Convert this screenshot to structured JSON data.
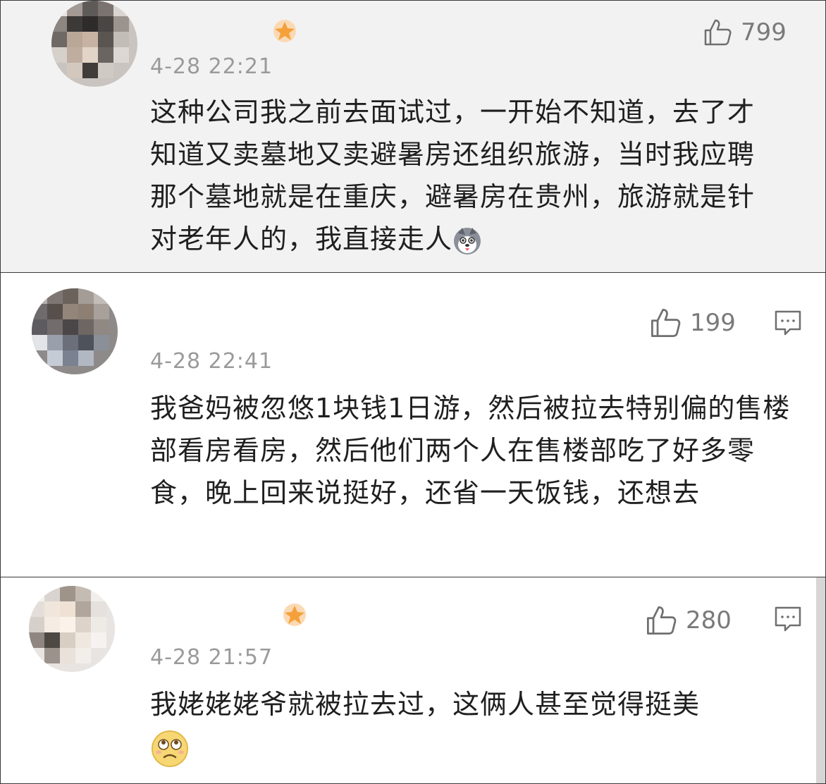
{
  "colors": {
    "background_first": "#f2f2f2",
    "text": "#1f1f1f",
    "timestamp": "#9a9a9a",
    "like_count": "#7a7a7a",
    "vip_badge": "#f5a03a"
  },
  "comments": [
    {
      "username": "",
      "timestamp": "4-28 22:21",
      "likes": "799",
      "text": "这种公司我之前去面试过，一开始不知道，去了才知道又卖墓地又卖避暑房还组织旅游，当时我应聘那个墓地就是在重庆，避暑房在贵州，旅游就是针对老年人的，我直接走人",
      "emoji": "husky-dog-emoji",
      "has_vip_badge": true,
      "has_reply_icon": false
    },
    {
      "username": "",
      "timestamp": "4-28 22:41",
      "likes": "199",
      "text": "我爸妈被忽悠1块钱1日游，然后被拉去特别偏的售楼部看房看房，然后他们两个人在售楼部吃了好多零食，晚上回来说挺好，还省一天饭钱，还想去",
      "has_vip_badge": false,
      "has_reply_icon": true
    },
    {
      "username": "",
      "timestamp": "4-28 21:57",
      "likes": "280",
      "text": "我姥姥姥爷就被拉去过，这俩人甚至觉得挺美",
      "emoji": "awkward-face-emoji",
      "has_vip_badge": true,
      "has_reply_icon": true
    }
  ]
}
